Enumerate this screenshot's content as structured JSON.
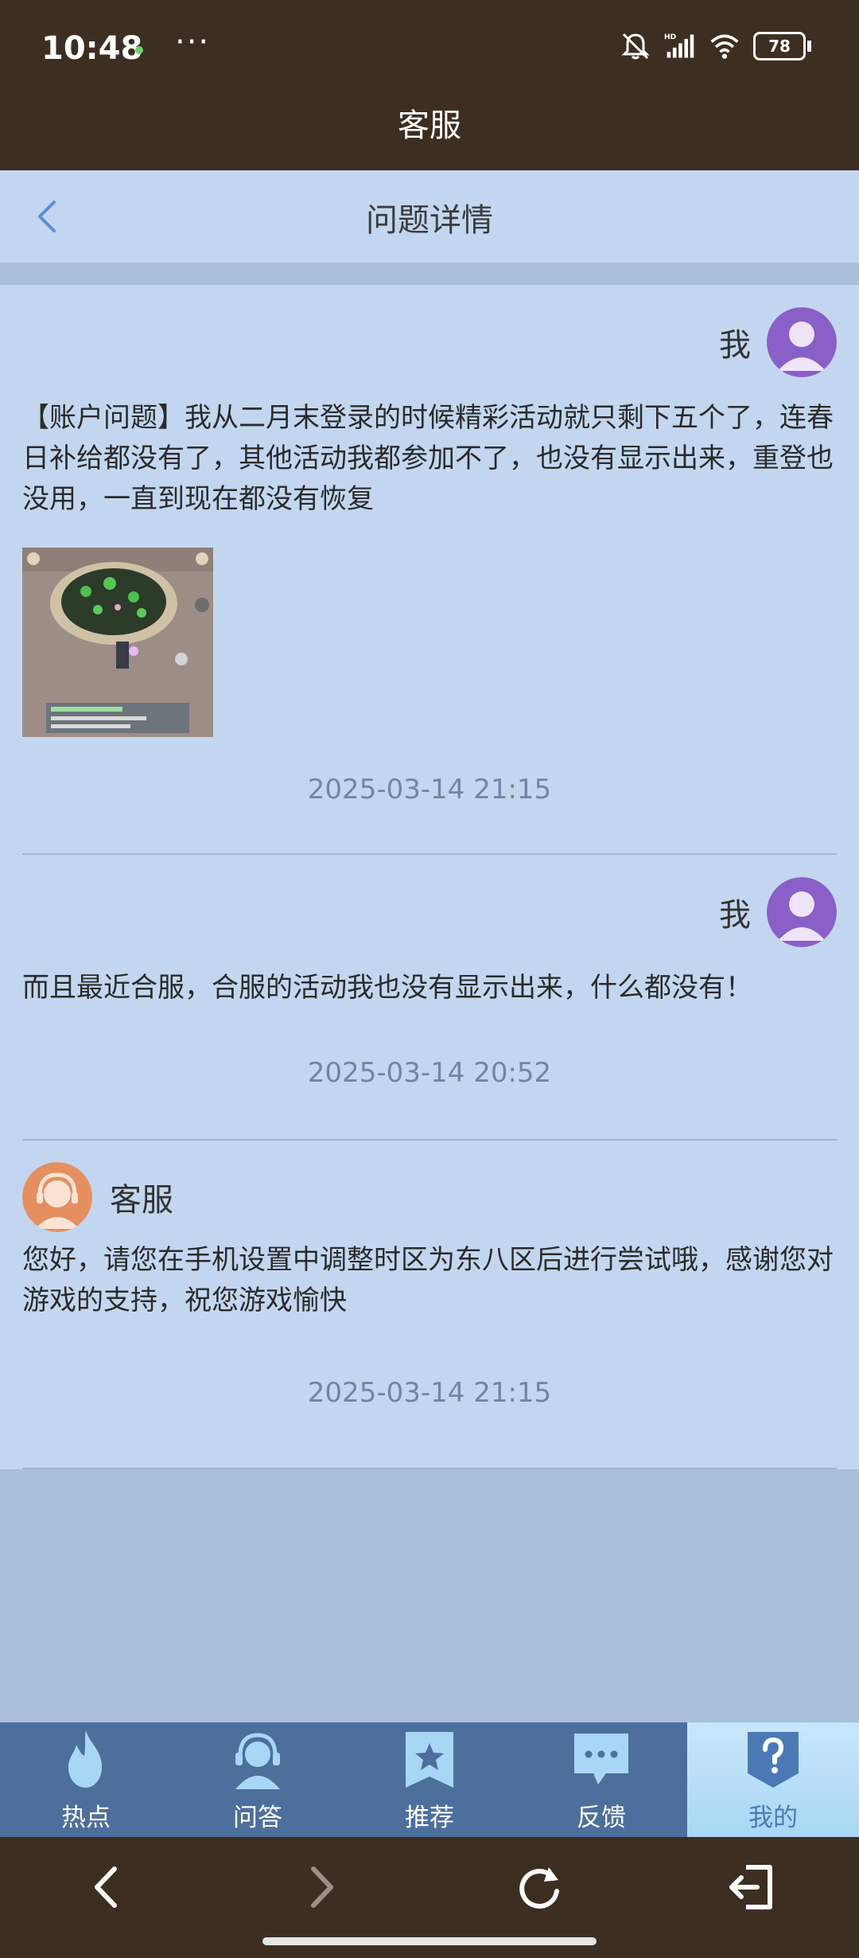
{
  "status_bar": {
    "time": "10:48",
    "more": "···",
    "icons": [
      "mute-bell-icon",
      "hd-signal-icon",
      "wifi-icon"
    ],
    "battery": "78"
  },
  "app_bar": {
    "title": "客服"
  },
  "page_header": {
    "title": "问题详情",
    "back_icon": "chevron-left-icon"
  },
  "messages": [
    {
      "sender": "我",
      "avatar": "user-avatar",
      "text": "【账户问题】我从二月末登录的时候精彩活动就只剩下五个了，连春日补给都没有了，其他活动我都参加不了，也没有显示出来，重登也没用，一直到现在都没有恢复",
      "has_image": true,
      "time": "2025-03-14 21:15"
    },
    {
      "sender": "我",
      "avatar": "user-avatar",
      "text": "而且最近合服，合服的活动我也没有显示出来，什么都没有！",
      "time": "2025-03-14 20:52"
    },
    {
      "sender": "客服",
      "avatar": "support-avatar",
      "text": "您好，请您在手机设置中调整时区为东八区后进行尝试哦，感谢您对游戏的支持，祝您游戏愉快",
      "time": "2025-03-14 21:15"
    }
  ],
  "tabs": [
    {
      "label": "热点",
      "icon": "flame-icon",
      "active": false
    },
    {
      "label": "问答",
      "icon": "headset-icon",
      "active": false
    },
    {
      "label": "推荐",
      "icon": "star-bookmark-icon",
      "active": false
    },
    {
      "label": "反馈",
      "icon": "chat-bubble-icon",
      "active": false
    },
    {
      "label": "我的",
      "icon": "question-shield-icon",
      "active": true
    }
  ],
  "browser_nav": [
    "back-arrow-icon",
    "forward-arrow-icon",
    "refresh-icon",
    "exit-icon"
  ],
  "colors": {
    "top_bar": "#3d2e22",
    "content_bg": "#c3d6ef",
    "page_bg": "#aabfd9",
    "tab_bar": "#4d6f9c",
    "active_tab": "#a9d6f5",
    "user_avatar": "#8a5fc7",
    "support_avatar": "#e58f60"
  }
}
